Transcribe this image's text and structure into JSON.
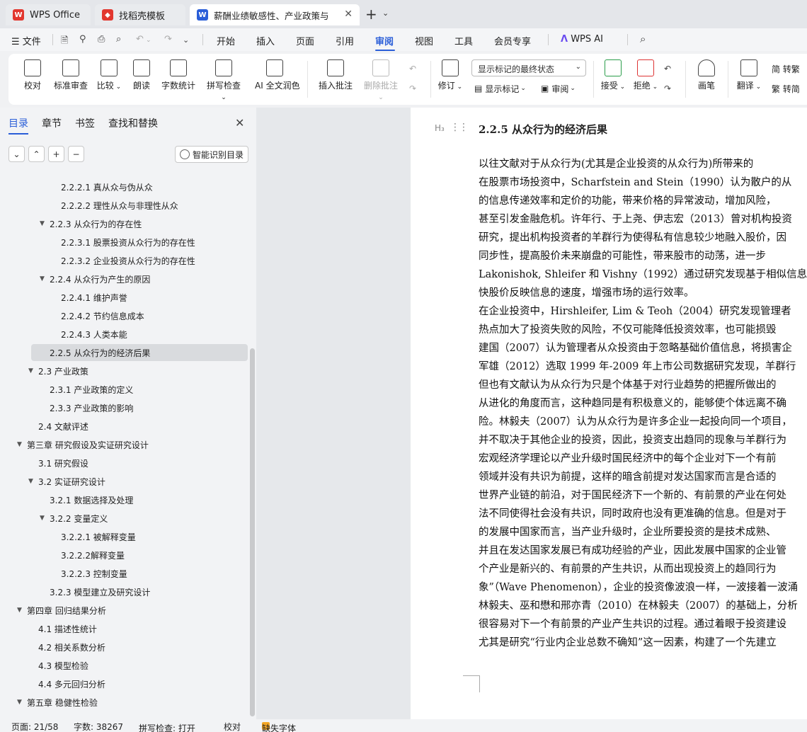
{
  "tabs": [
    {
      "label": "WPS Office",
      "icon": "wps-logo-icon"
    },
    {
      "label": "找稻壳模板",
      "icon": "docer-icon"
    },
    {
      "label": "薪酬业绩敏感性、产业政策与",
      "icon": "writer-icon"
    }
  ],
  "menu": [
    "文件",
    "开始",
    "插入",
    "页面",
    "引用",
    "审阅",
    "视图",
    "工具",
    "会员专享",
    "WPS AI"
  ],
  "ribbon": {
    "proofread": "校对",
    "standard_review": "标准审查",
    "compare": "比较",
    "read_aloud": "朗读",
    "word_count": "字数统计",
    "spell_check": "拼写检查",
    "ai_polish": "AI 全文润色",
    "insert_comment": "插入批注",
    "delete_comment": "删除批注",
    "revise": "修订",
    "markup_select": "显示标记的最终状态",
    "show_markup": "显示标记",
    "review": "审阅",
    "accept": "接受",
    "reject": "拒绝",
    "pen": "画笔",
    "translate": "翻译",
    "to_traditional": "简 转繁",
    "to_simplified": "繁 转简"
  },
  "sidebar": {
    "tabs": [
      "目录",
      "章节",
      "书签",
      "查找和替换"
    ],
    "smart_toc": "智能识别目录",
    "toc": [
      {
        "text": "2.2.2.1  真从众与伪从众",
        "level": 3,
        "tri": ""
      },
      {
        "text": "2.2.2.2  理性从众与非理性从众",
        "level": 3,
        "tri": ""
      },
      {
        "text": "2.2.3  从众行为的存在性",
        "level": 2,
        "tri": "▼"
      },
      {
        "text": "2.2.3.1  股票投资从众行为的存在性",
        "level": 3,
        "tri": ""
      },
      {
        "text": "2.2.3.2  企业投资从众行为的存在性",
        "level": 3,
        "tri": ""
      },
      {
        "text": "2.2.4 从众行为产生的原因",
        "level": 2,
        "tri": "▼"
      },
      {
        "text": "2.2.4.1  维护声誉",
        "level": 3,
        "tri": ""
      },
      {
        "text": "2.2.4.2  节约信息成本",
        "level": 3,
        "tri": ""
      },
      {
        "text": "2.2.4.3  人类本能",
        "level": 3,
        "tri": ""
      },
      {
        "text": "2.2.5  从众行为的经济后果",
        "level": 2,
        "tri": "",
        "selected": true
      },
      {
        "text": "2.3  产业政策",
        "level": 1,
        "tri": "▼"
      },
      {
        "text": "2.3.1  产业政策的定义",
        "level": 2,
        "tri": ""
      },
      {
        "text": "2.3.3  产业政策的影响",
        "level": 2,
        "tri": ""
      },
      {
        "text": "2.4  文献评述",
        "level": 1,
        "tri": ""
      },
      {
        "text": "第三章  研究假设及实证研究设计",
        "level": 0,
        "tri": "▼"
      },
      {
        "text": "3.1  研究假设",
        "level": 1,
        "tri": ""
      },
      {
        "text": "3.2  实证研究设计",
        "level": 1,
        "tri": "▼"
      },
      {
        "text": "3.2.1  数据选择及处理",
        "level": 2,
        "tri": ""
      },
      {
        "text": "3.2.2  变量定义",
        "level": 2,
        "tri": "▼"
      },
      {
        "text": "3.2.2.1  被解释变量",
        "level": 3,
        "tri": ""
      },
      {
        "text": "3.2.2.2解释变量",
        "level": 3,
        "tri": ""
      },
      {
        "text": "3.2.2.3  控制变量",
        "level": 3,
        "tri": ""
      },
      {
        "text": "3.2.3  模型建立及研究设计",
        "level": 2,
        "tri": ""
      },
      {
        "text": "第四章  回归结果分析",
        "level": 0,
        "tri": "▼"
      },
      {
        "text": "4.1  描述性统计",
        "level": 1,
        "tri": ""
      },
      {
        "text": "4.2  相关系数分析",
        "level": 1,
        "tri": ""
      },
      {
        "text": "4.3  模型检验",
        "level": 1,
        "tri": ""
      },
      {
        "text": "4.4  多元回归分析",
        "level": 1,
        "tri": ""
      },
      {
        "text": "第五章  稳健性检验",
        "level": 0,
        "tri": "▼"
      }
    ]
  },
  "document": {
    "heading": "2.2.5  从众行为的经济后果",
    "lines": [
      "    以往文献对于从众行为(尤其是企业投资的从众行为)所带来的",
      "    在股票市场投资中，Scharfstein and Stein（1990）认为散户的从",
      "的信息传递效率和定价的功能，带来价格的异常波动，增加风险，",
      "甚至引发金融危机。许年行、于上尧、伊志宏（2013）曾对机构投资",
      "研究，提出机构投资者的羊群行为使得私有信息较少地融入股价，因",
      "同步性，提高股价未来崩盘的可能性，带来股市的动荡，进一步",
      "Lakonishok, Shleifer 和 Vishny（1992）通过研究发现基于相似信息",
      "快股价反映信息的速度，增强市场的运行效率。",
      "    在企业投资中，Hirshleifer, Lim & Teoh（2004）研究发现管理者",
      "热点加大了投资失败的风险，不仅可能降低投资效率，也可能损毁",
      "建国（2007）认为管理者从众投资由于忽略基础价值信息，将损害企",
      "军雄（2012）选取 1999 年-2009 年上市公司数据研究发现，羊群行",
      "但也有文献认为从众行为只是个体基于对行业趋势的把握所做出的",
      "从进化的角度而言，这种趋同是有积极意义的，能够使个体远离不确",
      "险。林毅夫（2007）认为从众行为是许多企业一起投向同一个项目，",
      "并不取决于其他企业的投资，因此，投资支出趋同的现象与羊群行为",
      "宏观经济学理论以产业升级时国民经济中的每个企业对下一个有前",
      "领域并没有共识为前提，这样的暗含前提对发达国家而言是合适的",
      "世界产业链的前沿，对于国民经济下一个新的、有前景的产业在何处",
      "法不同使得社会没有共识，同时政府也没有更准确的信息。但是对于",
      "的发展中国家而言，当产业升级时，企业所要投资的是技术成熟、",
      "并且在发达国家发展已有成功经验的产业，因此发展中国家的企业管",
      "个产业是新兴的、有前景的产生共识，从而出现投资上的趋同行为",
      "象”（Wave Phenomenon），企业的投资像波浪一样，一波接着一波涌",
      "林毅夫、巫和懋和邢亦青（2010）在林毅夫（2007）的基础上，分析",
      "很容易对下一个有前景的产业产生共识的过程。通过着眼于投资建设",
      "尤其是研究“行业内企业总数不确知”这一因素，构建了一个先建立"
    ]
  },
  "status": {
    "page": "页面: 21/58",
    "words": "字数: 38267",
    "spell": "拼写检查: 打开",
    "proof": "校对",
    "missing_font": "缺失字体"
  },
  "colors": {
    "accent": "#2a5ed8",
    "wps_red": "#e2372f",
    "writer_blue": "#2a5ed8"
  }
}
